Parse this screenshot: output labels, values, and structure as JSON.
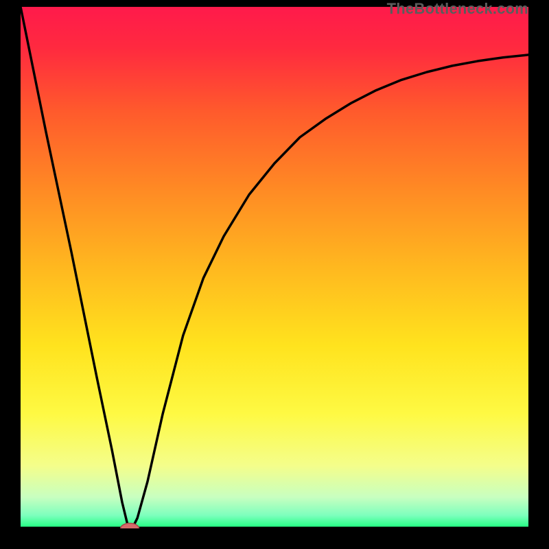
{
  "watermark": {
    "text": "TheBottleneck.com"
  },
  "gradient": {
    "stops": [
      {
        "offset": 0.0,
        "color": "#ff1a4b"
      },
      {
        "offset": 0.08,
        "color": "#ff2a3f"
      },
      {
        "offset": 0.2,
        "color": "#ff5a2c"
      },
      {
        "offset": 0.35,
        "color": "#ff8a24"
      },
      {
        "offset": 0.5,
        "color": "#ffb81f"
      },
      {
        "offset": 0.65,
        "color": "#ffe31e"
      },
      {
        "offset": 0.78,
        "color": "#fef943"
      },
      {
        "offset": 0.88,
        "color": "#f4fe8b"
      },
      {
        "offset": 0.94,
        "color": "#c8ffc0"
      },
      {
        "offset": 0.975,
        "color": "#7dffbd"
      },
      {
        "offset": 1.0,
        "color": "#1aff7d"
      }
    ]
  },
  "chart_data": {
    "type": "line",
    "title": "",
    "xlabel": "",
    "ylabel": "",
    "ylim": [
      0,
      100
    ],
    "xlim": [
      0,
      100
    ],
    "grid": false,
    "legend": null,
    "series": [
      {
        "name": "bottleneck-curve",
        "x": [
          0,
          5,
          10,
          15,
          18,
          20,
          21,
          22,
          23,
          25,
          28,
          32,
          36,
          40,
          45,
          50,
          55,
          60,
          65,
          70,
          75,
          80,
          85,
          90,
          95,
          100
        ],
        "y": [
          100,
          76,
          53,
          29,
          15,
          5,
          1,
          0,
          2,
          9,
          22,
          37,
          48,
          56,
          64,
          70,
          75,
          78.5,
          81.5,
          84,
          86,
          87.5,
          88.7,
          89.6,
          90.3,
          90.8
        ]
      }
    ],
    "marker": {
      "x": 21.5,
      "y": 0,
      "rx_pct": 1.8,
      "ry_pct": 1.0,
      "fill": "#d66a6a",
      "stroke": "#a84848"
    },
    "baseline": {
      "y": 0,
      "stroke": "#000000",
      "width": 5
    }
  }
}
